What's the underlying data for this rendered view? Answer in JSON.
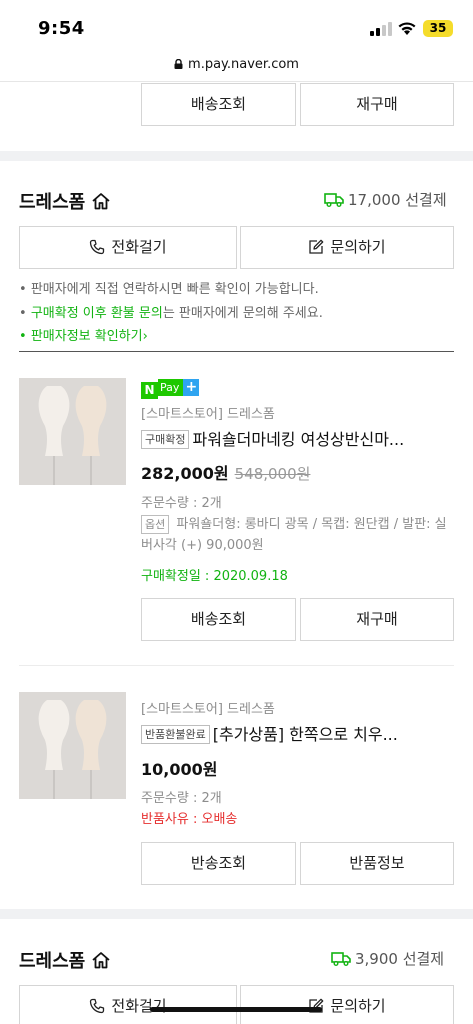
{
  "status_bar": {
    "time": "9:54",
    "battery": "35"
  },
  "browser": {
    "url": "m.pay.naver.com"
  },
  "top_buttons": {
    "delivery": "배송조회",
    "rebuy": "재구매"
  },
  "group1": {
    "seller": "드레스폼",
    "shipping": "17,000 선결제",
    "call_button": "전화걸기",
    "inquiry_button": "문의하기",
    "notice_1": "판매자에게 직접 연락하시면 빠른 확인이 가능합니다.",
    "notice_2_green": "구매확정 이후 환불 문의",
    "notice_2_rest": "는 판매자에게 문의해 주세요.",
    "seller_info_link": "판매자정보 확인하기",
    "seller_info_chevron": "›",
    "npay_n": "N",
    "npay_pay": "Pay",
    "npay_plus": "+",
    "item1": {
      "store": "[스마트스토어] 드레스폼",
      "status_tag": "구매확정",
      "title": "파워숄더마네킹 여성상반신마...",
      "price": "282,000원",
      "original_price": "548,000원",
      "quantity": "주문수량 : 2개",
      "option_tag": "옵션",
      "option_text": "파워숄더형: 롱바디 광목 / 목캡: 원단캡 / 발판: 실버사각 (+) 90,000원",
      "confirm_date": "구매확정일 : 2020.09.18",
      "btn_delivery": "배송조회",
      "btn_rebuy": "재구매"
    },
    "item2": {
      "store": "[스마트스토어] 드레스폼",
      "status_tag": "반품환불완료",
      "title": "[추가상품] 한쪽으로 치우...",
      "price": "10,000원",
      "quantity": "주문수량 : 2개",
      "return_reason": "반품사유 : 오배송",
      "btn_return": "반송조회",
      "btn_return_info": "반품정보"
    }
  },
  "group2": {
    "seller": "드레스폼",
    "shipping": "3,900 선결제",
    "call_button": "전화걸기",
    "inquiry_button": "문의하기"
  },
  "colors": {
    "accent_green": "#12b312",
    "npay_green": "#1ec800",
    "alert_red": "#e62f2f"
  }
}
